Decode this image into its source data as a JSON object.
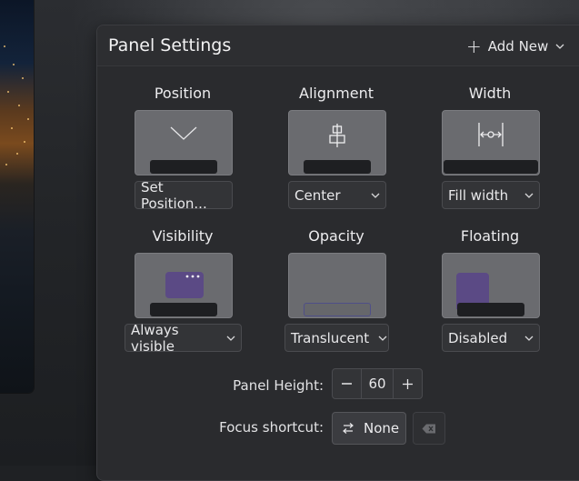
{
  "dialog": {
    "title": "Panel Settings",
    "add_new_label": "Add New"
  },
  "sections": {
    "position": {
      "title": "Position",
      "control_label": "Set Position..."
    },
    "alignment": {
      "title": "Alignment",
      "selected": "Center"
    },
    "width": {
      "title": "Width",
      "selected": "Fill width"
    },
    "visibility": {
      "title": "Visibility",
      "selected": "Always visible"
    },
    "opacity": {
      "title": "Opacity",
      "selected": "Translucent"
    },
    "floating": {
      "title": "Floating",
      "selected": "Disabled"
    }
  },
  "panel_height": {
    "label": "Panel Height:",
    "value": "60"
  },
  "focus_shortcut": {
    "label": "Focus shortcut:",
    "value": "None"
  },
  "colors": {
    "accent": "#5b4a85",
    "panel_bar": "#1e1f22",
    "preview_bg": "#6a6b6f",
    "dialog_bg": "#2a2b2e"
  },
  "icons": {
    "add": "plus-icon",
    "dropdown": "chevron-down-icon",
    "position": "chevron-down-icon",
    "alignment": "align-center-icon",
    "width": "fill-width-icon",
    "visibility_dots": "more-dots-icon",
    "decrease": "minus-icon",
    "increase": "plus-icon",
    "shortcut": "swap-arrows-icon",
    "clear": "backspace-clear-icon"
  }
}
